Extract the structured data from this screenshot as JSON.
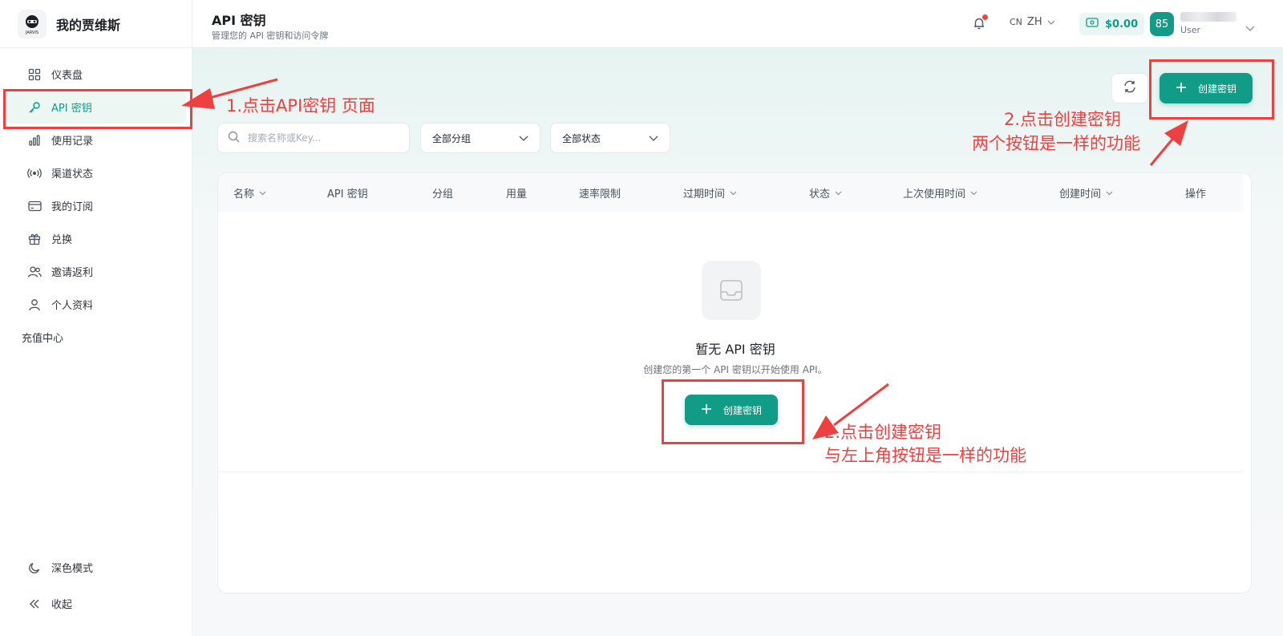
{
  "brand": {
    "name": "我的贾维斯",
    "logo_text": "JARVIS"
  },
  "sidebar": {
    "items": [
      {
        "label": "仪表盘",
        "icon": "dashboard-icon"
      },
      {
        "label": "API 密钥",
        "icon": "key-icon",
        "active": true
      },
      {
        "label": "使用记录",
        "icon": "bar-chart-icon"
      },
      {
        "label": "渠道状态",
        "icon": "signal-icon"
      },
      {
        "label": "我的订阅",
        "icon": "card-icon"
      },
      {
        "label": "兑换",
        "icon": "gift-icon"
      },
      {
        "label": "邀请返利",
        "icon": "users-icon"
      },
      {
        "label": "个人资料",
        "icon": "user-icon"
      }
    ],
    "recharge_label": "充值中心",
    "dark_mode_label": "深色模式",
    "collapse_label": "收起"
  },
  "header": {
    "title": "API 密钥",
    "subtitle": "管理您的 API 密钥和访问令牌",
    "lang_code": "CN",
    "lang_label": "ZH",
    "balance": "$0.00",
    "avatar_text": "85",
    "user_role": "User"
  },
  "toolbar": {
    "create_label": "创建密钥",
    "search_placeholder": "搜索名称或Key...",
    "group_select": "全部分组",
    "status_select": "全部状态"
  },
  "table": {
    "columns": [
      {
        "label": "名称",
        "sortable": true
      },
      {
        "label": "API 密钥",
        "sortable": false
      },
      {
        "label": "分组",
        "sortable": false
      },
      {
        "label": "用量",
        "sortable": false
      },
      {
        "label": "速率限制",
        "sortable": false
      },
      {
        "label": "过期时间",
        "sortable": true
      },
      {
        "label": "状态",
        "sortable": true
      },
      {
        "label": "上次使用时间",
        "sortable": true
      },
      {
        "label": "创建时间",
        "sortable": true
      },
      {
        "label": "操作",
        "sortable": false
      }
    ],
    "empty_title": "暂无 API 密钥",
    "empty_desc": "创建您的第一个 API 密钥以开始使用 API。",
    "empty_create_label": "创建密钥"
  },
  "annotations": {
    "note1": "1.点击API密钥 页面",
    "note2_line1": "2.点击创建密钥",
    "note2_line2": "两个按钮是一样的功能",
    "note3_line1": "2.点击创建密钥",
    "note3_line2": "与左上角按钮是一样的功能",
    "color": "#ee4040"
  },
  "colors": {
    "accent": "#119c87",
    "active_bg": "#ecf7f4"
  }
}
